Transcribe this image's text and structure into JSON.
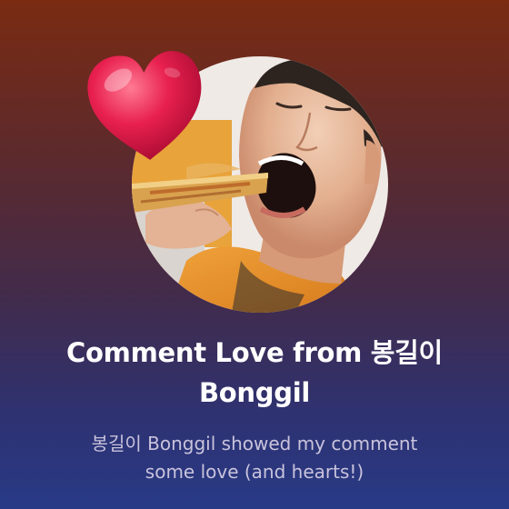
{
  "notification": {
    "title_line1": "Comment Love from 봉길이",
    "title_line2": "Bonggil",
    "description_line1": "봉길이 Bonggil showed my comment",
    "description_line2": "some love (and hearts!)"
  },
  "icons": {
    "heart": "heart-icon"
  },
  "colors": {
    "background_top": "#7a2b12",
    "background_bottom": "#283a86",
    "heart": "#e8204f",
    "title_text": "#ffffff",
    "description_text": "#c9c3dc"
  }
}
